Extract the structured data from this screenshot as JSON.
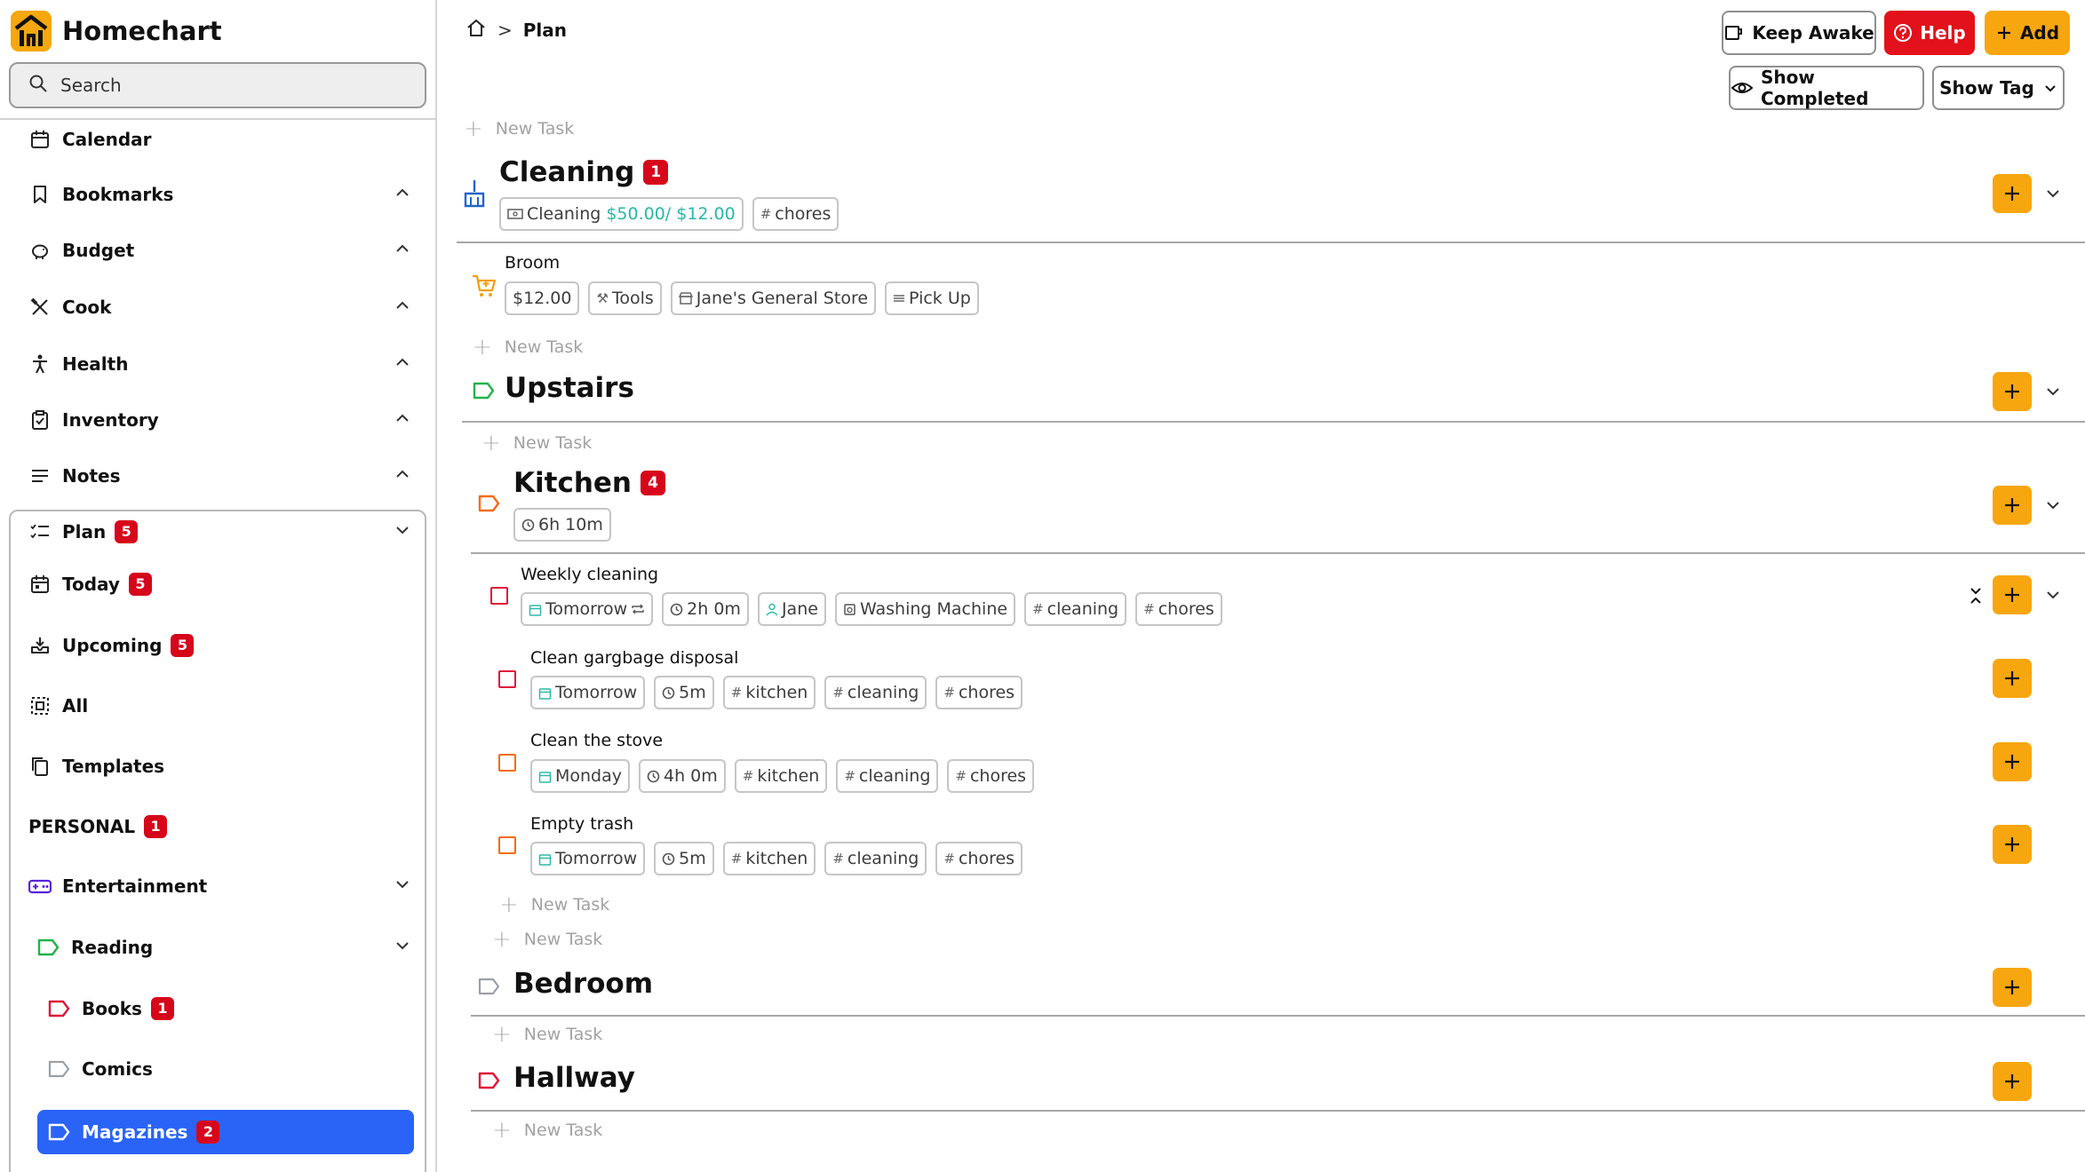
{
  "app": {
    "name": "Homechart"
  },
  "search": {
    "placeholder": "Search"
  },
  "sidebar": {
    "items": [
      {
        "label": "Calendar"
      },
      {
        "label": "Bookmarks"
      },
      {
        "label": "Budget"
      },
      {
        "label": "Cook"
      },
      {
        "label": "Health"
      },
      {
        "label": "Inventory"
      },
      {
        "label": "Notes"
      }
    ],
    "plan": {
      "label": "Plan",
      "count": "5"
    },
    "today": {
      "label": "Today",
      "count": "5"
    },
    "upcoming": {
      "label": "Upcoming",
      "count": "5"
    },
    "all": {
      "label": "All"
    },
    "templates": {
      "label": "Templates"
    },
    "personal": {
      "label": "PERSONAL",
      "count": "1"
    },
    "entertainment": {
      "label": "Entertainment"
    },
    "reading": {
      "label": "Reading"
    },
    "books": {
      "label": "Books",
      "count": "1"
    },
    "comics": {
      "label": "Comics"
    },
    "magazines": {
      "label": "Magazines",
      "count": "2"
    }
  },
  "breadcrumb": {
    "current": "Plan"
  },
  "toolbar": {
    "keep_awake": "Keep Awake",
    "help": "Help",
    "add": "Add",
    "show_completed": "Show Completed",
    "show_tag": "Show Tag"
  },
  "new_task": "New Task",
  "projects": {
    "cleaning": {
      "title": "Cleaning",
      "count": "1",
      "budget_label": "Cleaning",
      "budget_value": "$50.00/ $12.00",
      "tag": "chores"
    },
    "broom": {
      "name": "Broom",
      "price": "$12.00",
      "category": "Tools",
      "store": "Jane's General Store",
      "status": "Pick Up"
    },
    "upstairs": {
      "title": "Upstairs"
    },
    "kitchen": {
      "title": "Kitchen",
      "count": "4",
      "duration": "6h 10m"
    },
    "bedroom": {
      "title": "Bedroom"
    },
    "hallway": {
      "title": "Hallway"
    }
  },
  "tasks": {
    "weekly": {
      "name": "Weekly cleaning",
      "date": "Tomorrow",
      "duration": "2h 0m",
      "assignee": "Jane",
      "item": "Washing Machine",
      "tags": [
        "cleaning",
        "chores"
      ]
    },
    "disposal": {
      "name": "Clean gargbage disposal",
      "date": "Tomorrow",
      "duration": "5m",
      "tags": [
        "kitchen",
        "cleaning",
        "chores"
      ]
    },
    "stove": {
      "name": "Clean the stove",
      "date": "Monday",
      "duration": "4h 0m",
      "tags": [
        "kitchen",
        "cleaning",
        "chores"
      ]
    },
    "trash": {
      "name": "Empty trash",
      "date": "Tomorrow",
      "duration": "5m",
      "tags": [
        "kitchen",
        "cleaning",
        "chores"
      ]
    }
  },
  "colors": {
    "accent": "#f7a610",
    "danger": "#e3111b",
    "badge": "#d6071b",
    "selected": "#2a64f6",
    "teal": "#27b7a7",
    "green": "#21b24b",
    "orange": "#f56b15",
    "red": "#e0153a"
  }
}
